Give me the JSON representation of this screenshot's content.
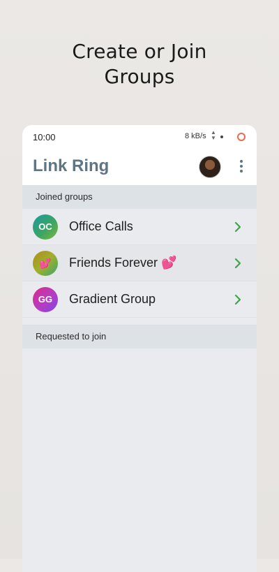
{
  "headline": {
    "line1": "Create or Join",
    "line2": "Groups"
  },
  "status_bar": {
    "time": "10:00",
    "speed": "8 kB/s",
    "arrows": "▲▼"
  },
  "app": {
    "title": "Link Ring",
    "avatar_icon": "user-avatar",
    "menu_icon": "more-vertical-icon"
  },
  "sections": {
    "joined": "Joined groups",
    "requested": "Requested to join"
  },
  "groups": [
    {
      "initials": "OC",
      "name": "Office Calls"
    },
    {
      "initials": "💕",
      "name": "Friends Forever 💕"
    },
    {
      "initials": "GG",
      "name": "Gradient Group"
    }
  ],
  "colors": {
    "accent": "#5d7585",
    "chevron": "#3fa34d",
    "status_ring": "#ef6a4c"
  }
}
